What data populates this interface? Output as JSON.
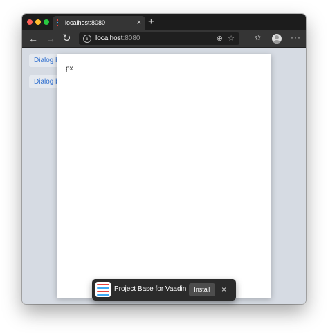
{
  "browser": {
    "tab": {
      "title": "localhost:8080",
      "close_glyph": "×"
    },
    "new_tab_glyph": "+",
    "toolbar": {
      "back_glyph": "←",
      "forward_glyph": "→",
      "reload_glyph": "↻",
      "info_glyph": "i",
      "url_host": "localhost",
      "url_port": ":8080",
      "install_icon_glyph": "⊕",
      "star_glyph": "☆",
      "favorites_glyph": "✩",
      "menu_glyph": "···"
    },
    "icons": {
      "tab_favicon": "vaadin-favicon",
      "info": "info-icon",
      "install_app": "install-app-icon",
      "favorite": "star-icon",
      "favorites_list": "favorites-icon",
      "profile": "avatar-icon",
      "menu": "more-icon"
    }
  },
  "page": {
    "buttons": [
      {
        "label": "Dialog b"
      },
      {
        "label": "Dialog b"
      }
    ],
    "dialog": {
      "text": "px"
    }
  },
  "install_prompt": {
    "title": "Project Base for Vaadin",
    "install_label": "Install",
    "close_glyph": "×",
    "logo_colors": [
      "#e8433f",
      "#3fa9f5",
      "#e8433f",
      "#3fa9f5"
    ]
  },
  "colors": {
    "page_background": "#d6dbe3",
    "button_text": "#2f6fcf",
    "chrome_dark": "#1c1c1c",
    "toolbar": "#353535"
  }
}
